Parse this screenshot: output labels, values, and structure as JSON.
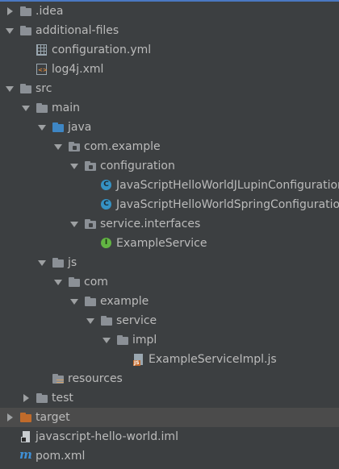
{
  "tree": {
    "items": [
      {
        "label": ".idea",
        "icon": "folder-icon"
      },
      {
        "label": "additional-files",
        "icon": "folder-icon"
      },
      {
        "label": "configuration.yml",
        "icon": "yml-file-icon"
      },
      {
        "label": "log4j.xml",
        "icon": "xml-file-icon"
      },
      {
        "label": "src",
        "icon": "folder-icon"
      },
      {
        "label": "main",
        "icon": "folder-icon"
      },
      {
        "label": "java",
        "icon": "source-folder-icon"
      },
      {
        "label": "com.example",
        "icon": "package-icon"
      },
      {
        "label": "configuration",
        "icon": "package-icon"
      },
      {
        "label": "JavaScriptHelloWorldJLupinConfiguration",
        "icon": "class-icon"
      },
      {
        "label": "JavaScriptHelloWorldSpringConfiguration",
        "icon": "class-icon"
      },
      {
        "label": "service.interfaces",
        "icon": "package-icon"
      },
      {
        "label": "ExampleService",
        "icon": "interface-icon"
      },
      {
        "label": "js",
        "icon": "folder-icon"
      },
      {
        "label": "com",
        "icon": "folder-icon"
      },
      {
        "label": "example",
        "icon": "folder-icon"
      },
      {
        "label": "service",
        "icon": "folder-icon"
      },
      {
        "label": "impl",
        "icon": "folder-icon"
      },
      {
        "label": "ExampleServiceImpl.js",
        "icon": "javascript-file-icon"
      },
      {
        "label": "resources",
        "icon": "resources-folder-icon"
      },
      {
        "label": "test",
        "icon": "folder-icon"
      },
      {
        "label": "target",
        "icon": "excluded-folder-icon"
      },
      {
        "label": "javascript-hello-world.iml",
        "icon": "iml-file-icon"
      },
      {
        "label": "pom.xml",
        "icon": "maven-icon"
      }
    ],
    "badges": {
      "class": "C",
      "interface": "I",
      "xml": "<>",
      "js": "JS",
      "maven": "m"
    },
    "colors": {
      "background": "#3c3f41",
      "text": "#bbbbbb",
      "source_folder": "#3e86c4",
      "excluded_folder": "#c06b2b",
      "selection": "#4b4b4b"
    }
  }
}
